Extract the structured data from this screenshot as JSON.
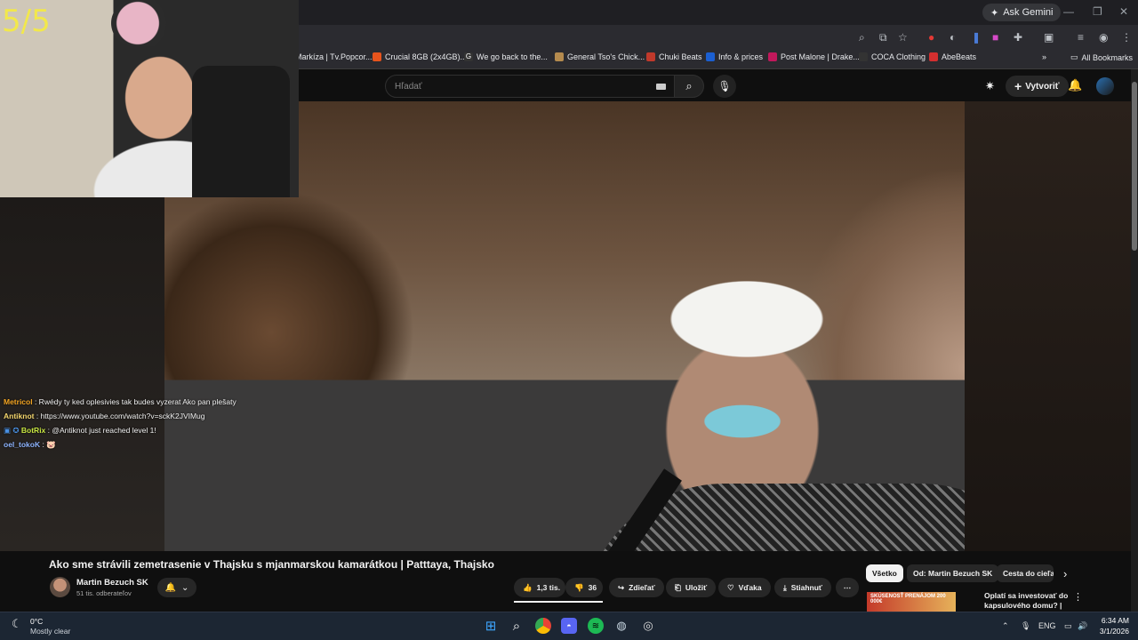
{
  "stream_overlay": {
    "counter": "5/5",
    "chat": [
      {
        "user": "Metricol",
        "user_color": "#f5a623",
        "text": " : Rwédy ty ked oplesivies tak budes vyzerat Ako pan plešaty"
      },
      {
        "user": "Antiknot",
        "user_color": "#f5d76e",
        "text": " : https://www.youtube.com/watch?v=sckK2JVIMug"
      },
      {
        "user": "BotRix",
        "user_color": "#c8e642",
        "text": " : @Antiknot just reached level 1!"
      },
      {
        "user": "oel_tokoK",
        "user_color": "#8fb5ff",
        "text": " : 🐷"
      }
    ]
  },
  "browser": {
    "ask_gemini": "Ask Gemini",
    "bookmarks": [
      {
        "label": "Markíza | Tv.Popcor...",
        "color": "#1a1a1a"
      },
      {
        "label": "Crucial 8GB (2x4GB)...",
        "color": "#e8541c"
      },
      {
        "label": "We go back to the...",
        "color": "#333333"
      },
      {
        "label": "General Tso's Chick...",
        "color": "#b58b4e"
      },
      {
        "label": "Chuki Beats",
        "color": "#c0392b"
      },
      {
        "label": "Info & prices",
        "color": "#1b5fd1"
      },
      {
        "label": "Post Malone | Drake...",
        "color": "#c2185b"
      },
      {
        "label": "COCA Clothing",
        "color": "#333333"
      },
      {
        "label": "AbeBeats",
        "color": "#d32f2f"
      }
    ],
    "all_bookmarks": "All Bookmarks"
  },
  "youtube": {
    "search_placeholder": "Hľadať",
    "create_label": "Vytvoriť",
    "video_title": "Ako sme strávili zemetrasenie v Thajsku s mjanmarskou kamarátkou | Patttaya, Thajsko",
    "channel_name": "Martin Bezuch SK",
    "subscribers": "51 tis. odberateľov",
    "likes": "1,3 tis.",
    "dislikes": "36",
    "share": "Zdieľať",
    "save": "Uložiť",
    "thanks": "Vďaka",
    "download": "Stiahnuť",
    "chips": [
      "Všetko",
      "Od: Martin Bezuch SK",
      "Cesta do cieľa"
    ],
    "recommendation_title": "Oplatí sa investovať do kapsulového domu? | Pattaya, ...",
    "recommendation_thumb_text": "SKÚSENOSŤ PRENÁJOM 200 000€"
  },
  "taskbar": {
    "temperature": "0°C",
    "weather": "Mostly clear",
    "language": "ENG",
    "time": "6:34 AM",
    "date": "3/1/2026"
  }
}
